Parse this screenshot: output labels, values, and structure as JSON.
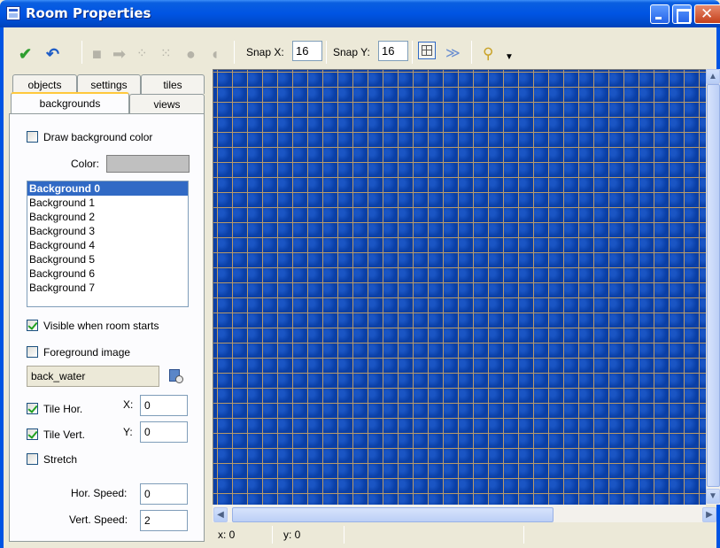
{
  "window": {
    "title": "Room Properties"
  },
  "toolbar": {
    "snap_x_label": "Snap X:",
    "snap_x_value": "16",
    "snap_y_label": "Snap Y:",
    "snap_y_value": "16"
  },
  "tabs": {
    "row1": [
      "objects",
      "settings",
      "tiles"
    ],
    "row2": [
      "backgrounds",
      "views"
    ],
    "active": "backgrounds"
  },
  "backgrounds": {
    "draw_color_label": "Draw background color",
    "color_label": "Color:",
    "color_value": "#c0c0c0",
    "list": [
      "Background 0",
      "Background 1",
      "Background 2",
      "Background 3",
      "Background 4",
      "Background 5",
      "Background 6",
      "Background 7"
    ],
    "selected_index": 0,
    "visible_label": "Visible when room starts",
    "foreground_label": "Foreground image",
    "image_name": "back_water",
    "tile_hor_label": "Tile Hor.",
    "tile_vert_label": "Tile Vert.",
    "x_label": "X:",
    "x_value": "0",
    "y_label": "Y:",
    "y_value": "0",
    "stretch_label": "Stretch",
    "hor_speed_label": "Hor. Speed:",
    "hor_speed_value": "0",
    "vert_speed_label": "Vert. Speed:",
    "vert_speed_value": "2"
  },
  "status": {
    "x": "x: 0",
    "y": "y: 0"
  }
}
